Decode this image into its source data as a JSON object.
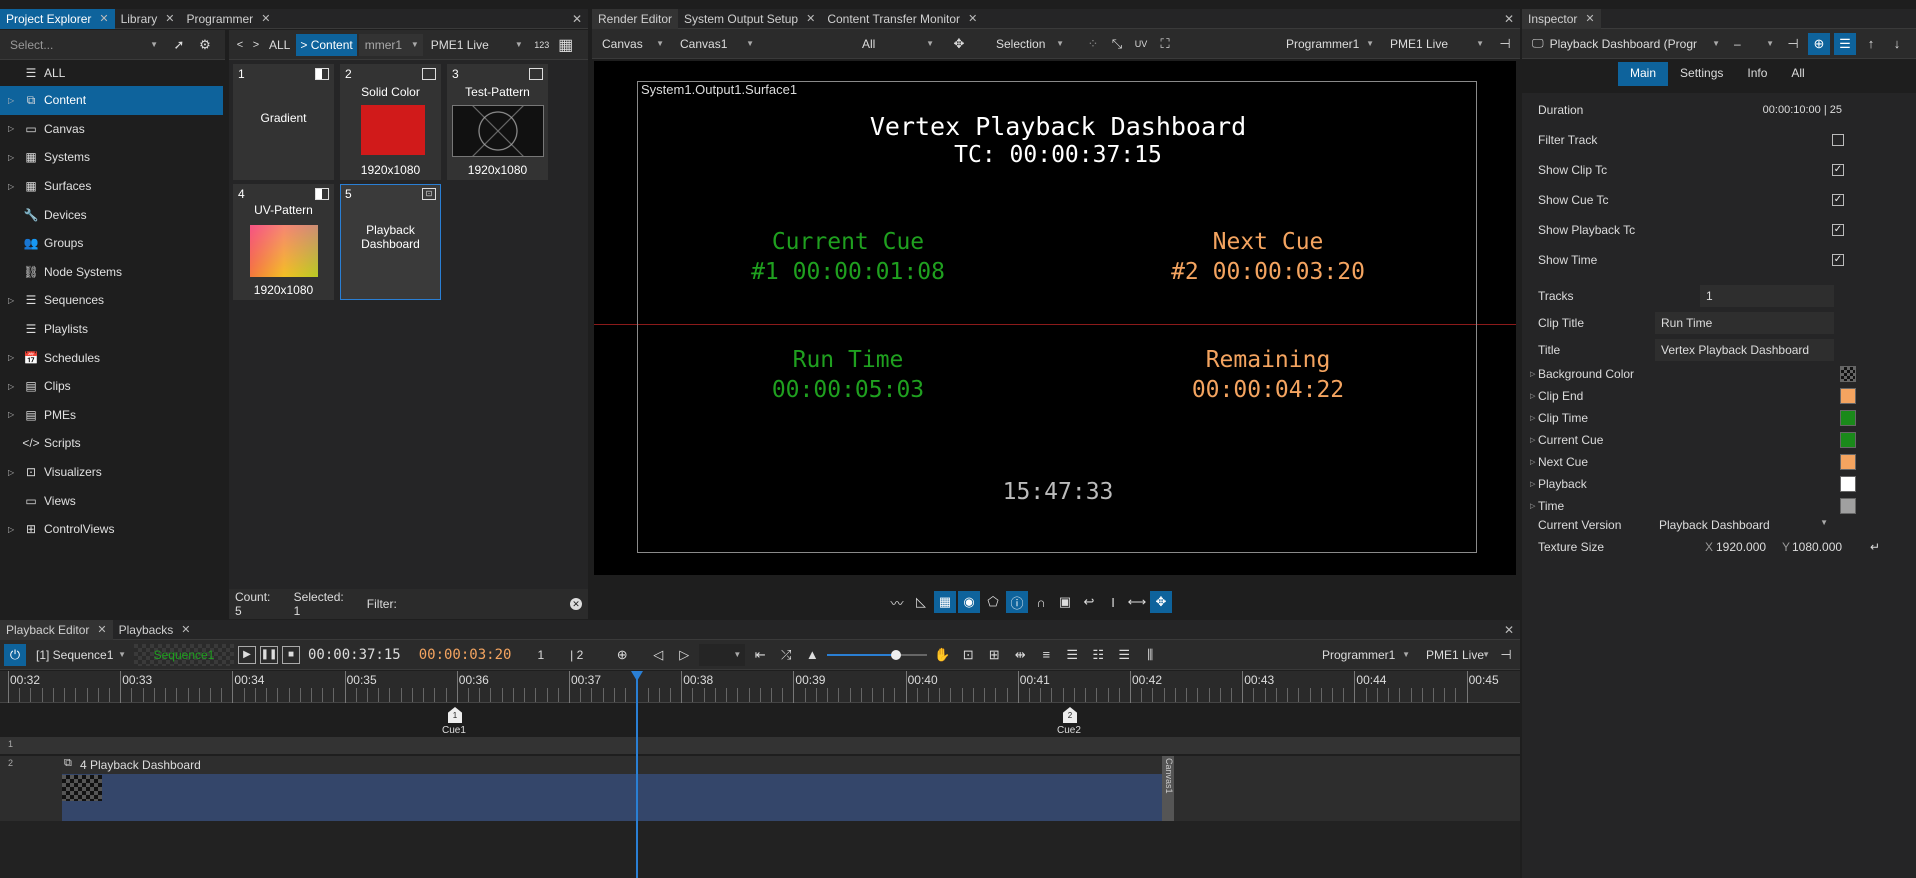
{
  "project_explorer": {
    "tabs": [
      "Project Explorer",
      "Library",
      "Programmer"
    ],
    "search_placeholder": "Select...",
    "tree": [
      "ALL",
      "Content",
      "Canvas",
      "Systems",
      "Surfaces",
      "Devices",
      "Groups",
      "Node Systems",
      "Sequences",
      "Playlists",
      "Schedules",
      "Clips",
      "PMEs",
      "Scripts",
      "Visualizers",
      "Views",
      "ControlViews"
    ],
    "crumb_all": "ALL",
    "crumb_content": "> Content",
    "programmer_dd": "mmer1",
    "pme_dd": "PME1 Live",
    "num_icon": "123",
    "items": [
      {
        "num": "1",
        "title": "Gradient",
        "res": ""
      },
      {
        "num": "2",
        "title": "Solid Color",
        "res": "1920x1080"
      },
      {
        "num": "3",
        "title": "Test-Pattern",
        "res": "1920x1080"
      },
      {
        "num": "4",
        "title": "UV-Pattern",
        "res": "1920x1080"
      },
      {
        "num": "5",
        "title": "Playback Dashboard",
        "res": ""
      }
    ],
    "count": "Count: 5",
    "selected": "Selected: 1",
    "filter": "Filter:"
  },
  "render_editor": {
    "tabs": [
      "Render Editor",
      "System Output Setup",
      "Content Transfer Monitor"
    ],
    "canvas_dd": "Canvas",
    "canvas1_dd": "Canvas1",
    "all_dd": "All",
    "selection_dd": "Selection",
    "programmer_dd": "Programmer1",
    "pme_dd": "PME1 Live",
    "surface_label": "System1.Output1.Surface1",
    "dashboard": {
      "title": "Vertex Playback Dashboard",
      "tc": "TC: 00:00:37:15",
      "current_cue_label": "Current Cue",
      "current_cue_value": "#1 00:00:01:08",
      "next_cue_label": "Next Cue",
      "next_cue_value": "#2 00:00:03:20",
      "run_time_label": "Run Time",
      "run_time_value": "00:00:05:03",
      "remaining_label": "Remaining",
      "remaining_value": "00:00:04:22",
      "clock": "15:47:33"
    }
  },
  "inspector": {
    "tab": "Inspector",
    "header_dd": "Playback Dashboard (Progr",
    "header_dd2": "–",
    "subtabs": [
      "Main",
      "Settings",
      "Info",
      "All"
    ],
    "duration_label": "Duration",
    "duration_value": "00:00:10:00 | 25",
    "checks": [
      {
        "label": "Filter Track",
        "checked": false
      },
      {
        "label": "Show Clip Tc",
        "checked": true
      },
      {
        "label": "Show Cue Tc",
        "checked": true
      },
      {
        "label": "Show Playback Tc",
        "checked": true
      },
      {
        "label": "Show Time",
        "checked": true
      }
    ],
    "tracks_label": "Tracks",
    "tracks_value": "1",
    "clip_title_label": "Clip Title",
    "clip_title_value": "Run Time",
    "title_label": "Title",
    "title_value": "Vertex Playback Dashboard",
    "colors": [
      {
        "label": "Background Color",
        "color": "checker"
      },
      {
        "label": "Clip End",
        "color": "#f4a460"
      },
      {
        "label": "Clip Time",
        "color": "#1a8a1a"
      },
      {
        "label": "Current Cue",
        "color": "#1a8a1a"
      },
      {
        "label": "Next Cue",
        "color": "#f4a460"
      },
      {
        "label": "Playback",
        "color": "#ffffff"
      },
      {
        "label": "Time",
        "color": "#a0a0a0"
      }
    ],
    "version_label": "Current Version",
    "version_value": "Playback Dashboard",
    "texture_label": "Texture Size",
    "tex_x_label": "X",
    "tex_x": "1920.000",
    "tex_y_label": "Y",
    "tex_y": "1080.000"
  },
  "playback": {
    "tabs": [
      "Playback Editor",
      "Playbacks"
    ],
    "sequence_dd": "[1] Sequence1",
    "sequence_name": "Sequence1",
    "tc_current": "00:00:37:15",
    "tc_next": "00:00:03:20",
    "cue_num": "1",
    "cue_total": "| 2",
    "programmer_dd": "Programmer1",
    "pme_dd": "PME1 Live",
    "ruler": [
      "00:32",
      "00:33",
      "00:34",
      "00:35",
      "00:36",
      "00:37",
      "00:38",
      "00:39",
      "00:40",
      "00:41",
      "00:42",
      "00:43",
      "00:44",
      "00:45"
    ],
    "cues": [
      {
        "label": "Cue1",
        "num": "1"
      },
      {
        "label": "Cue2",
        "num": "2"
      }
    ],
    "tracks": [
      "1",
      "2"
    ],
    "clip_label": "4 Playback Dashboard",
    "clip_end_label": "Canvas1"
  },
  "colors": {
    "accent": "#0e639c",
    "green": "#1fa01f",
    "orange": "#f4a460"
  }
}
